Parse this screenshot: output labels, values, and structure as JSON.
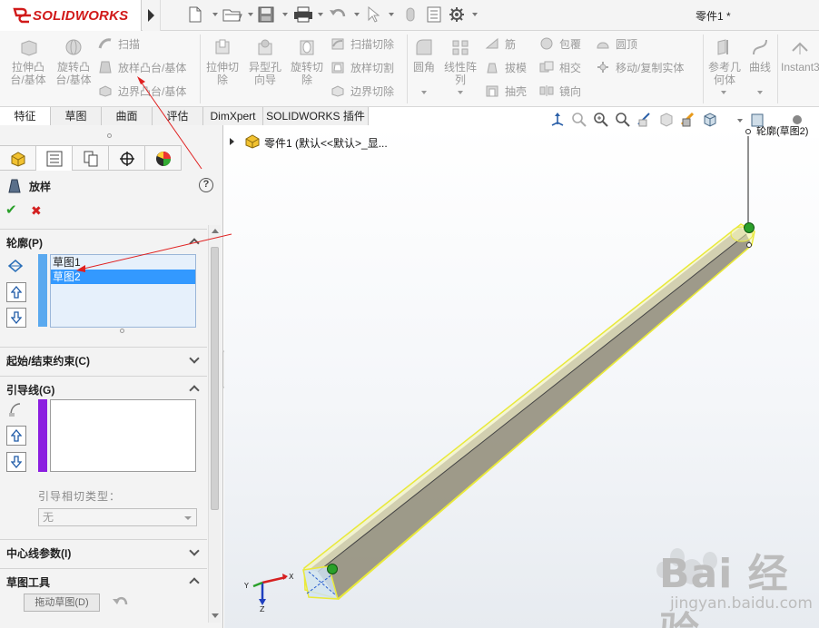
{
  "app": {
    "name": "SOLIDWORKS",
    "document_title": "零件1 *"
  },
  "ribbon": {
    "extrude_boss": "拉伸凸\n台/基体",
    "revolve_boss": "旋转凸\n台/基体",
    "sweep": "扫描",
    "loft_boss": "放样凸台/基体",
    "boundary_boss": "边界凸台/基体",
    "extrude_cut": "拉伸切\n除",
    "hole_wizard": "异型孔\n向导",
    "revolve_cut": "旋转切\n除",
    "sweep_cut": "扫描切除",
    "loft_cut": "放样切割",
    "boundary_cut": "边界切除",
    "fillet": "圆角",
    "linear_pattern": "线性阵\n列",
    "rib": "筋",
    "draft": "拔模",
    "shell": "抽壳",
    "wrap": "包覆",
    "intersect": "相交",
    "mirror": "镜向",
    "dome": "圆顶",
    "move_copy": "移动/复制实体",
    "ref_geometry": "参考几\n何体",
    "curves": "曲线",
    "instant3d": "Instant3D"
  },
  "tabs": [
    "特征",
    "草图",
    "曲面",
    "评估",
    "DimXpert",
    "SOLIDWORKS 插件"
  ],
  "property_manager": {
    "title": "放样",
    "help": "?",
    "ok": "✔",
    "cancel": "✖",
    "profile_group": "轮廓(P)",
    "profiles": [
      "草图1",
      "草图2"
    ],
    "start_end_group": "起始/结束约束(C)",
    "guide_group": "引导线(G)",
    "guide_tangency_label": "引导相切类型：",
    "guide_tangency_value": "无",
    "centerline_group": "中心线参数(I)",
    "sketch_tools_group": "草图工具",
    "drag_sketch": "拖动草图(D)"
  },
  "viewport": {
    "tree_label": "零件1 (默认<<默认>_显...",
    "profile_tag": "轮廓(草图2)",
    "watermark": "Bai 经验",
    "watermark_url": "jingyan.baidu.com"
  },
  "colors": {
    "brand_red": "#d11a1a",
    "selection_blue": "#3399ff",
    "profile_bar": "#5aa9ef",
    "guide_bar": "#8b1ee0",
    "loft_preview_yellow": "#f2f24a",
    "annotation_arrow": "#e02020"
  }
}
